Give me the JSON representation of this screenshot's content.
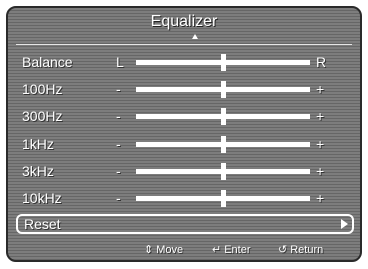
{
  "title": "Equalizer",
  "rows": [
    {
      "label": "Balance",
      "left": "L",
      "right": "R",
      "value": 0.5
    },
    {
      "label": "100Hz",
      "left": "-",
      "right": "+",
      "value": 0.5
    },
    {
      "label": "300Hz",
      "left": "-",
      "right": "+",
      "value": 0.5
    },
    {
      "label": "1kHz",
      "left": "-",
      "right": "+",
      "value": 0.5
    },
    {
      "label": "3kHz",
      "left": "-",
      "right": "+",
      "value": 0.5
    },
    {
      "label": "10kHz",
      "left": "-",
      "right": "+",
      "value": 0.5
    }
  ],
  "reset": {
    "label": "Reset"
  },
  "footer": {
    "move_icon": "updown-arrows-icon",
    "move_label": "Move",
    "enter_icon": "enter-icon",
    "enter_label": "Enter",
    "return_icon": "return-icon",
    "return_label": "Return"
  },
  "colors": {
    "panel": "#7d7d7d",
    "text": "#ffffff"
  }
}
